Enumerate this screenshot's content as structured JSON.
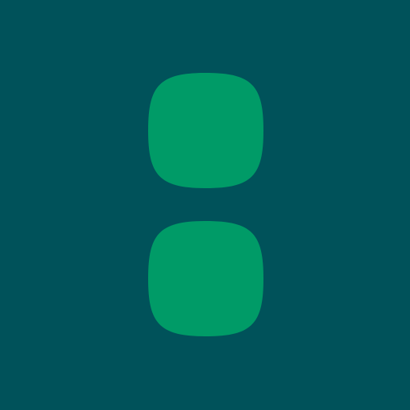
{
  "colors": {
    "background": "#00525A",
    "shape": "#009B67"
  },
  "icon": {
    "name": "two-stacked-squircles-icon",
    "shapes": [
      "top-squircle",
      "bottom-squircle"
    ]
  }
}
